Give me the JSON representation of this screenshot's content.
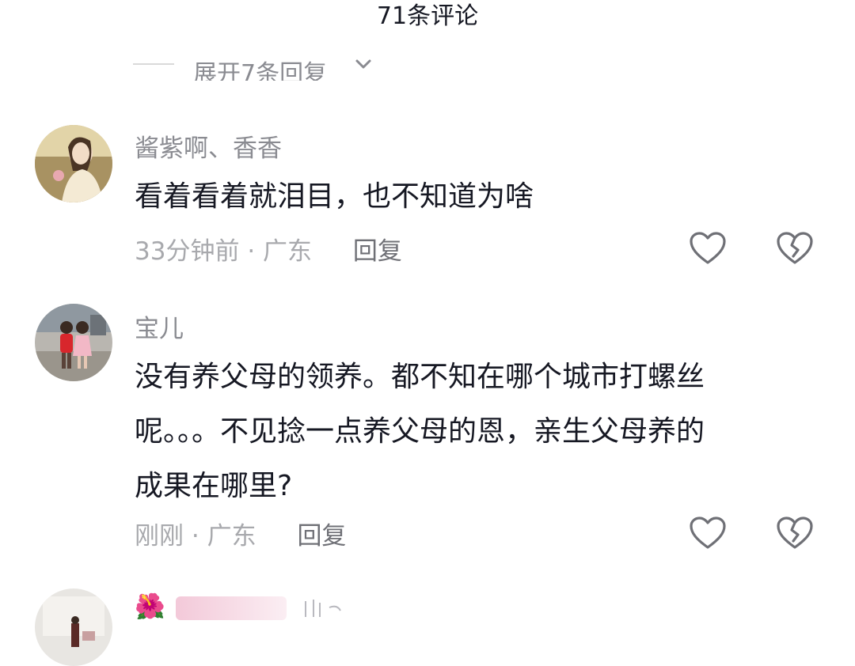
{
  "header": {
    "title": "71条评论"
  },
  "expand": {
    "label": "展开7条回复",
    "icon": "chevron-down-icon"
  },
  "comments": [
    {
      "username": "酱紫啊、香香",
      "content": "看着看着就泪目，也不知道为啥",
      "time": "33分钟前",
      "location": "广东",
      "reply_label": "回复",
      "like_icon": "heart-outline-icon",
      "dislike_icon": "broken-heart-icon"
    },
    {
      "username": "宝儿",
      "content_lines": [
        "没有养父母的领养。都不知在哪个城市打螺丝",
        "呢。。。不见捻一点养父母的恩，亲生父母养的",
        "成果在哪里?"
      ],
      "time": "刚刚",
      "location": "广东",
      "reply_label": "回复",
      "like_icon": "heart-outline-icon",
      "dislike_icon": "broken-heart-icon"
    },
    {
      "username_emoji": "🌺",
      "avatar": "avatar"
    }
  ],
  "colors": {
    "primary_text": "#161823",
    "secondary_text": "#8a8b91",
    "meta_text": "#a8a9ad",
    "icon_stroke": "#6f7076"
  }
}
